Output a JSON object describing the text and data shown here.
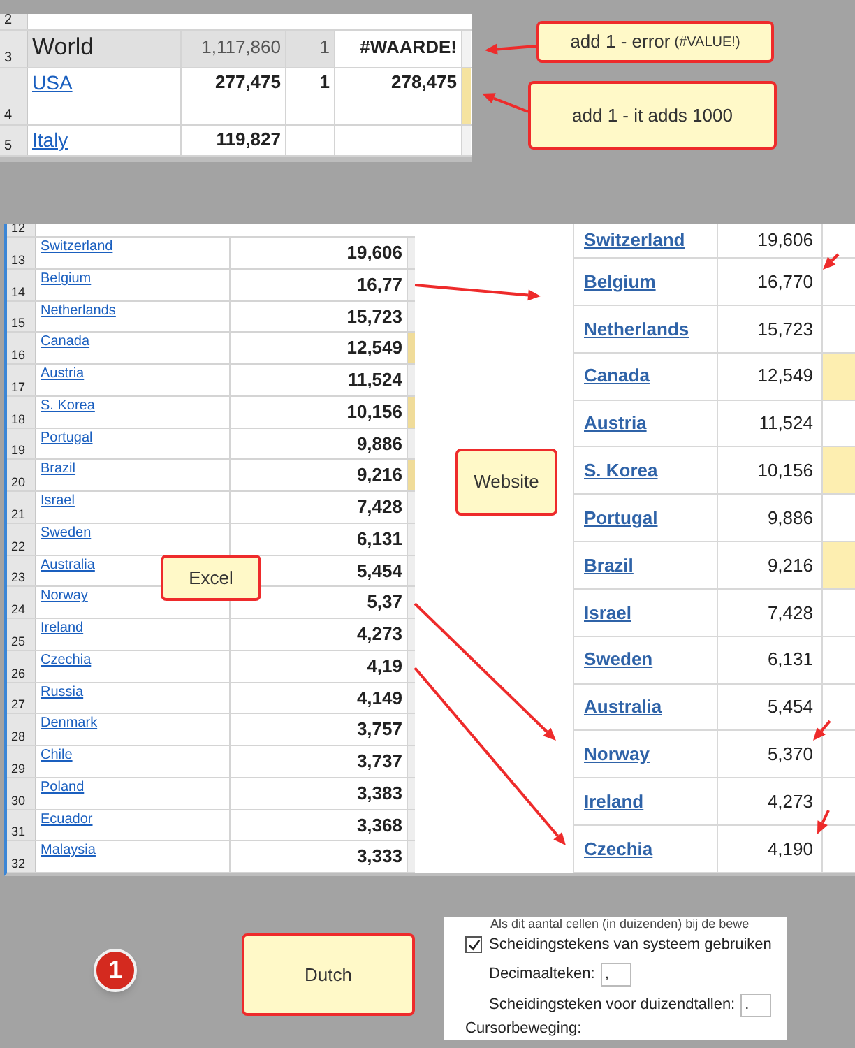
{
  "summary_sheet": {
    "rows": [
      {
        "row": "2",
        "kind": "partial"
      },
      {
        "row": "3",
        "kind": "total",
        "name": "World",
        "col_b": "1,117,860",
        "col_c": "1",
        "col_d": "#WAARDE!",
        "marked": false
      },
      {
        "row": "4",
        "kind": "country",
        "name": "USA",
        "col_b": "277,475",
        "col_c": "1",
        "col_d": "278,475",
        "marked": true
      },
      {
        "row": "5",
        "kind": "country",
        "name": "Italy",
        "col_b": "119,827",
        "marked": false
      }
    ]
  },
  "error_callout": {
    "text": "add 1 - error",
    "note": "(#VALUE!)"
  },
  "adds_callout": {
    "text": "add 1 - it adds 1000"
  },
  "excel_sheet": {
    "label": "Excel",
    "rows": [
      {
        "row": "12",
        "kind": "partial"
      },
      {
        "row": "13",
        "kind": "country",
        "name": "Switzerland",
        "value": "19,606",
        "marked": false
      },
      {
        "row": "14",
        "kind": "country",
        "name": "Belgium",
        "value": "16,77",
        "marked": false
      },
      {
        "row": "15",
        "kind": "country",
        "name": "Netherlands",
        "value": "15,723",
        "marked": false
      },
      {
        "row": "16",
        "kind": "country",
        "name": "Canada",
        "value": "12,549",
        "marked": true
      },
      {
        "row": "17",
        "kind": "country",
        "name": "Austria",
        "value": "11,524",
        "marked": false
      },
      {
        "row": "18",
        "kind": "country",
        "name": "S. Korea",
        "value": "10,156",
        "marked": true
      },
      {
        "row": "19",
        "kind": "country",
        "name": "Portugal",
        "value": "9,886",
        "marked": false
      },
      {
        "row": "20",
        "kind": "country",
        "name": "Brazil",
        "value": "9,216",
        "marked": true
      },
      {
        "row": "21",
        "kind": "country",
        "name": "Israel",
        "value": "7,428",
        "marked": false
      },
      {
        "row": "22",
        "kind": "country",
        "name": "Sweden",
        "value": "6,131",
        "marked": false
      },
      {
        "row": "23",
        "kind": "country",
        "name": "Australia",
        "value": "5,454",
        "marked": false
      },
      {
        "row": "24",
        "kind": "country",
        "name": "Norway",
        "value": "5,37",
        "marked": false
      },
      {
        "row": "25",
        "kind": "country",
        "name": "Ireland",
        "value": "4,273",
        "marked": false
      },
      {
        "row": "26",
        "kind": "country",
        "name": "Czechia",
        "value": "4,19",
        "marked": false
      },
      {
        "row": "27",
        "kind": "country",
        "name": "Russia",
        "value": "4,149",
        "marked": false
      },
      {
        "row": "28",
        "kind": "country",
        "name": "Denmark",
        "value": "3,757",
        "marked": false
      },
      {
        "row": "29",
        "kind": "country",
        "name": "Chile",
        "value": "3,737",
        "marked": false
      },
      {
        "row": "30",
        "kind": "country",
        "name": "Poland",
        "value": "3,383",
        "marked": false
      },
      {
        "row": "31",
        "kind": "country",
        "name": "Ecuador",
        "value": "3,368",
        "marked": false
      },
      {
        "row": "32",
        "kind": "country",
        "name": "Malaysia",
        "value": "3,333",
        "marked": false
      }
    ]
  },
  "website_table": {
    "label": "Website",
    "rows": [
      {
        "name": "Switzerland",
        "value": "19,606",
        "marked": false
      },
      {
        "name": "Belgium",
        "value": "16,770",
        "marked": false
      },
      {
        "name": "Netherlands",
        "value": "15,723",
        "marked": false
      },
      {
        "name": "Canada",
        "value": "12,549",
        "marked": true
      },
      {
        "name": "Austria",
        "value": "11,524",
        "marked": false
      },
      {
        "name": "S. Korea",
        "value": "10,156",
        "marked": true
      },
      {
        "name": "Portugal",
        "value": "9,886",
        "marked": false
      },
      {
        "name": "Brazil",
        "value": "9,216",
        "marked": true
      },
      {
        "name": "Israel",
        "value": "7,428",
        "marked": false
      },
      {
        "name": "Sweden",
        "value": "6,131",
        "marked": false
      },
      {
        "name": "Australia",
        "value": "5,454",
        "marked": false
      },
      {
        "name": "Norway",
        "value": "5,370",
        "marked": false
      },
      {
        "name": "Ireland",
        "value": "4,273",
        "marked": false
      },
      {
        "name": "Czechia",
        "value": "4,190",
        "marked": false
      }
    ]
  },
  "step_badge": {
    "text": "1"
  },
  "locale_callout": {
    "text": "Dutch"
  },
  "options_dialog": {
    "cut_line": "Als dit aantal cellen (in duizenden) bij de bewe",
    "checkbox": {
      "label": "Scheidingstekens van systeem gebruiken",
      "checked": true
    },
    "fields": [
      {
        "label": "Decimaalteken:",
        "value": ","
      },
      {
        "label": "Scheidingsteken voor duizendtallen:",
        "value": "."
      }
    ],
    "section": "Cursorbeweging:"
  }
}
